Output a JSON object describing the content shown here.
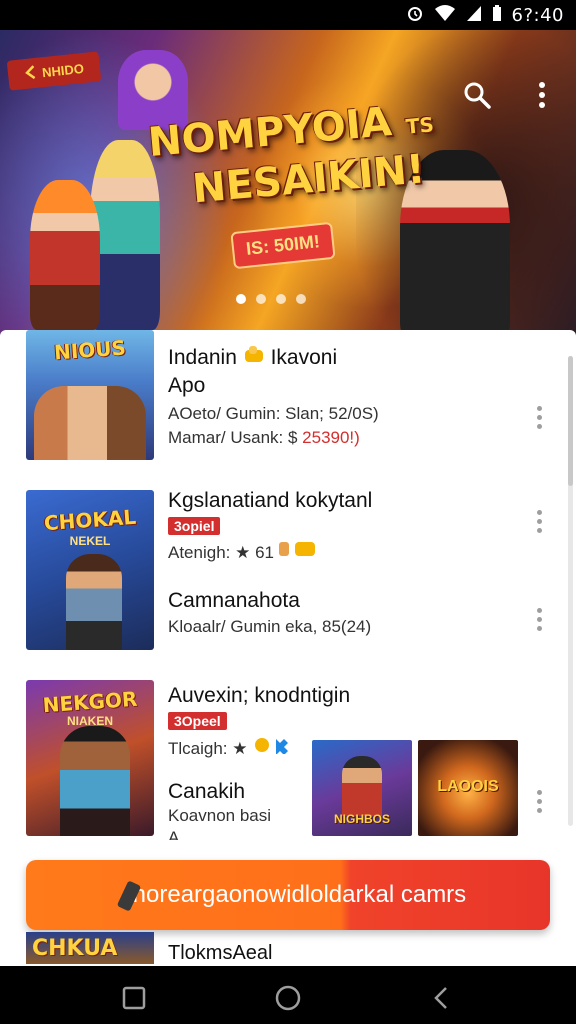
{
  "status_bar": {
    "time": "6?:40"
  },
  "hero": {
    "title_line1": "NOMPYOIA",
    "title_suffix": "TS",
    "title_line2": "NESAIKIN!",
    "promo": "IS: 50IM!",
    "back_tag": "NHIDO",
    "dots": 4,
    "active_dot": 0
  },
  "items": [
    {
      "thumb_title": "NIOUS",
      "title_line1": "Indanin",
      "title_line1b": "Ikavoni",
      "title_line2": "Apo",
      "meta1": "AOeto/ Gumin: Slan; 52/0S)",
      "meta2_prefix": "Mamar/ Usank: $ ",
      "meta2_price": "25390!)"
    },
    {
      "thumb_title": "CHOKAL",
      "thumb_sub": "NEKEL",
      "title": "Kgslanatiand kokytanl",
      "badge": "3opiel",
      "meta": "Atenigh: ★ 61",
      "title2": "Camnanahota",
      "meta2": "Kloaalr/ Gumin eka, 85(24)"
    },
    {
      "thumb_title": "NEKGOR",
      "thumb_sub": "NIAKEN",
      "title": "Auvexin; knodntigin",
      "badge": "3Opeel",
      "meta": "Tlcaigh: ★",
      "title2": "Canakih",
      "meta2": "Koavnon basi",
      "meta3": "A"
    }
  ],
  "mini_cards": [
    {
      "label": "NIGHBOS"
    },
    {
      "label": "LAOOIS"
    }
  ],
  "cta": {
    "label": "Inoreargaonowidloldarkal camrs"
  },
  "peek": {
    "thumb_title": "CHKUA",
    "text": "TlokmsAeal"
  },
  "colors": {
    "accent": "#ff6f1a",
    "price_red": "#d32f2f",
    "badge_red": "#d32f2f"
  }
}
